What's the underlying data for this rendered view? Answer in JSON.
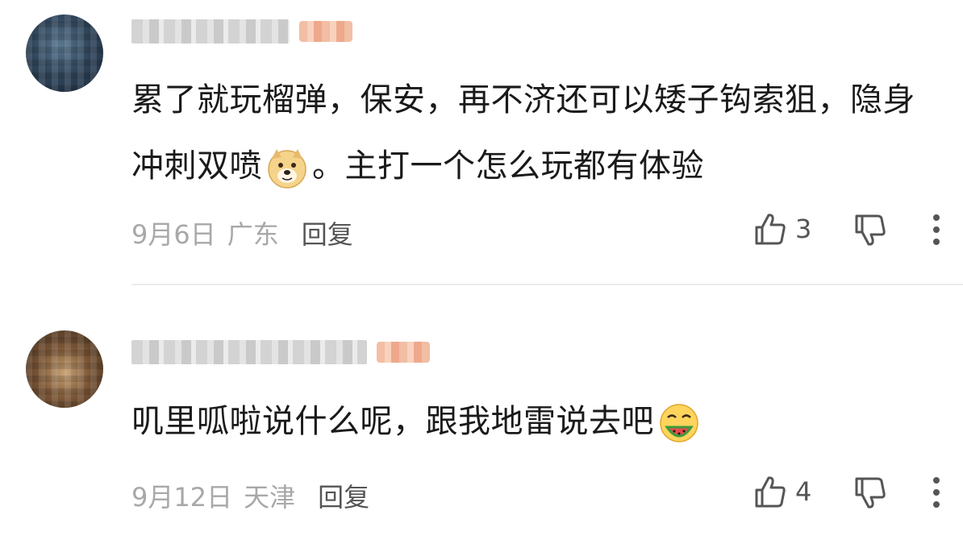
{
  "comments": [
    {
      "avatar_icon": "avatar-blurred",
      "text_part1": "累了就玩榴弹，保安，再不济还可以矮子钩索狙，隐身冲刺双喷",
      "emoji": "doge-emoji",
      "text_part2": "。主打一个怎么玩都有体验",
      "date": "9月6日",
      "location": "广东",
      "reply_label": "回复",
      "like_count": "3"
    },
    {
      "avatar_icon": "avatar-blurred",
      "text_part1": "叽里呱啦说什么呢，跟我地雷说去吧",
      "emoji": "watermelon-eating-emoji",
      "text_part2": "",
      "date": "9月12日",
      "location": "天津",
      "reply_label": "回复",
      "like_count": "4"
    }
  ],
  "colors": {
    "text": "#1a1a1a",
    "meta": "#a8a8a8",
    "divider": "#ececec"
  },
  "icons": [
    "thumbs-up-icon",
    "thumbs-down-icon",
    "more-vertical-icon"
  ]
}
